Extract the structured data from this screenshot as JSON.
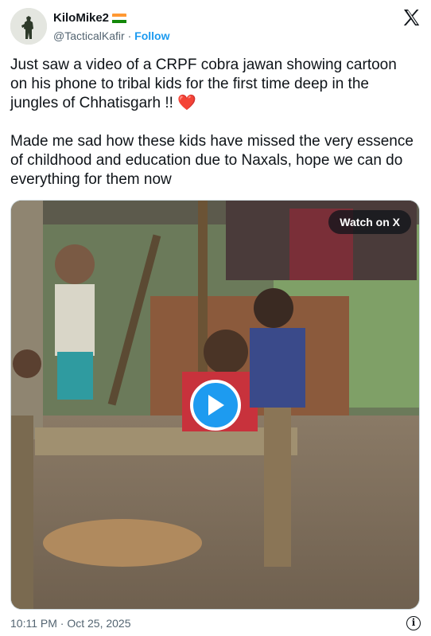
{
  "author": {
    "display_name": "KiloMike2",
    "flag_icon": "india-flag-icon",
    "handle": "@TacticalKafir",
    "separator": "·",
    "follow_label": "Follow"
  },
  "logo_icon": "x-logo-icon",
  "tweet": {
    "paragraph1": "Just saw a video of a CRPF cobra jawan showing cartoon on his phone to tribal kids for the first time deep in the jungles of Chhatisgarh !! ",
    "heart": "❤️",
    "paragraph2": "Made me sad how these kids have missed the very essence of childhood and education due to Naxals, hope we can do everything for them now"
  },
  "media": {
    "watch_label": "Watch on X",
    "play_icon": "play-icon"
  },
  "footer": {
    "timestamp": "10:11 PM · Oct 25, 2025",
    "info_icon": "info-icon"
  },
  "colors": {
    "accent": "#1d9bf0",
    "secondary_text": "#536471",
    "heart": "#e0245e"
  }
}
